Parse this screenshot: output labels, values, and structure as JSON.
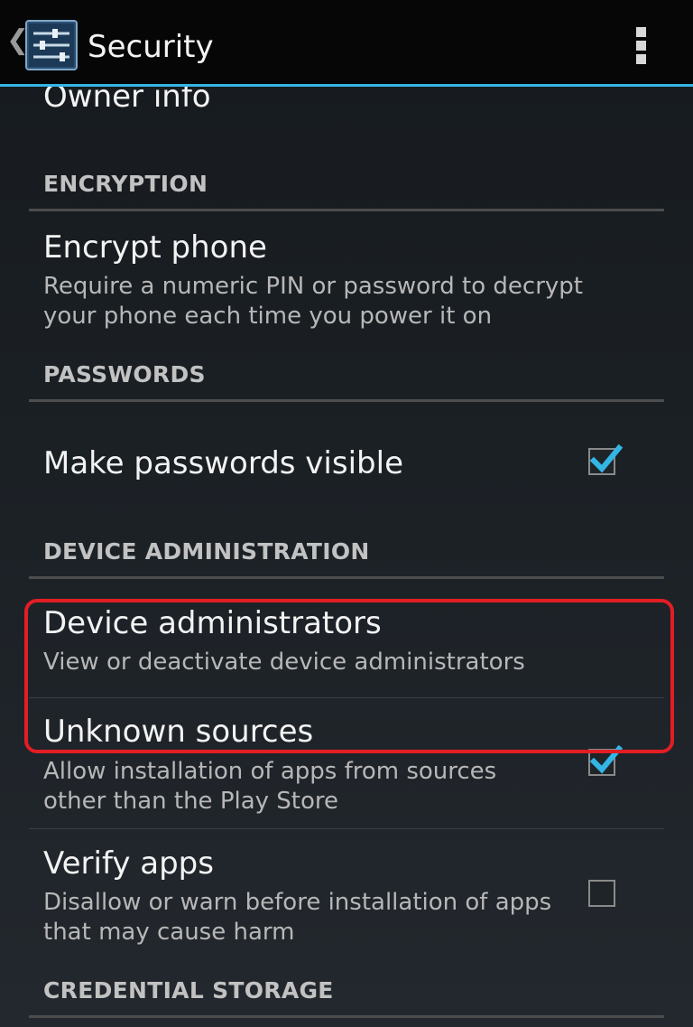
{
  "action_bar": {
    "title": "Security",
    "up_icon": "chevron-left-icon",
    "app_icon": "settings-sliders-icon",
    "overflow_icon": "overflow-menu-icon",
    "accent": "#33b5e5"
  },
  "list": {
    "owner_info": {
      "title": "Owner info"
    },
    "sections": {
      "encryption": "ENCRYPTION",
      "passwords": "PASSWORDS",
      "device_administration": "DEVICE ADMINISTRATION",
      "credential_storage": "CREDENTIAL STORAGE"
    },
    "encrypt_phone": {
      "title": "Encrypt phone",
      "summary": "Require a numeric PIN or password to decrypt your phone each time you power it on"
    },
    "make_passwords_visible": {
      "title": "Make passwords visible",
      "checked": true
    },
    "device_administrators": {
      "title": "Device administrators",
      "summary": "View or deactivate device administrators"
    },
    "unknown_sources": {
      "title": "Unknown sources",
      "summary": "Allow installation of apps from sources other than the Play Store",
      "checked": true
    },
    "verify_apps": {
      "title": "Verify apps",
      "summary": "Disallow or warn before installation of apps that may cause harm",
      "checked": false
    }
  },
  "colors": {
    "highlight": "#e31d24",
    "check": "#33b5e5"
  }
}
